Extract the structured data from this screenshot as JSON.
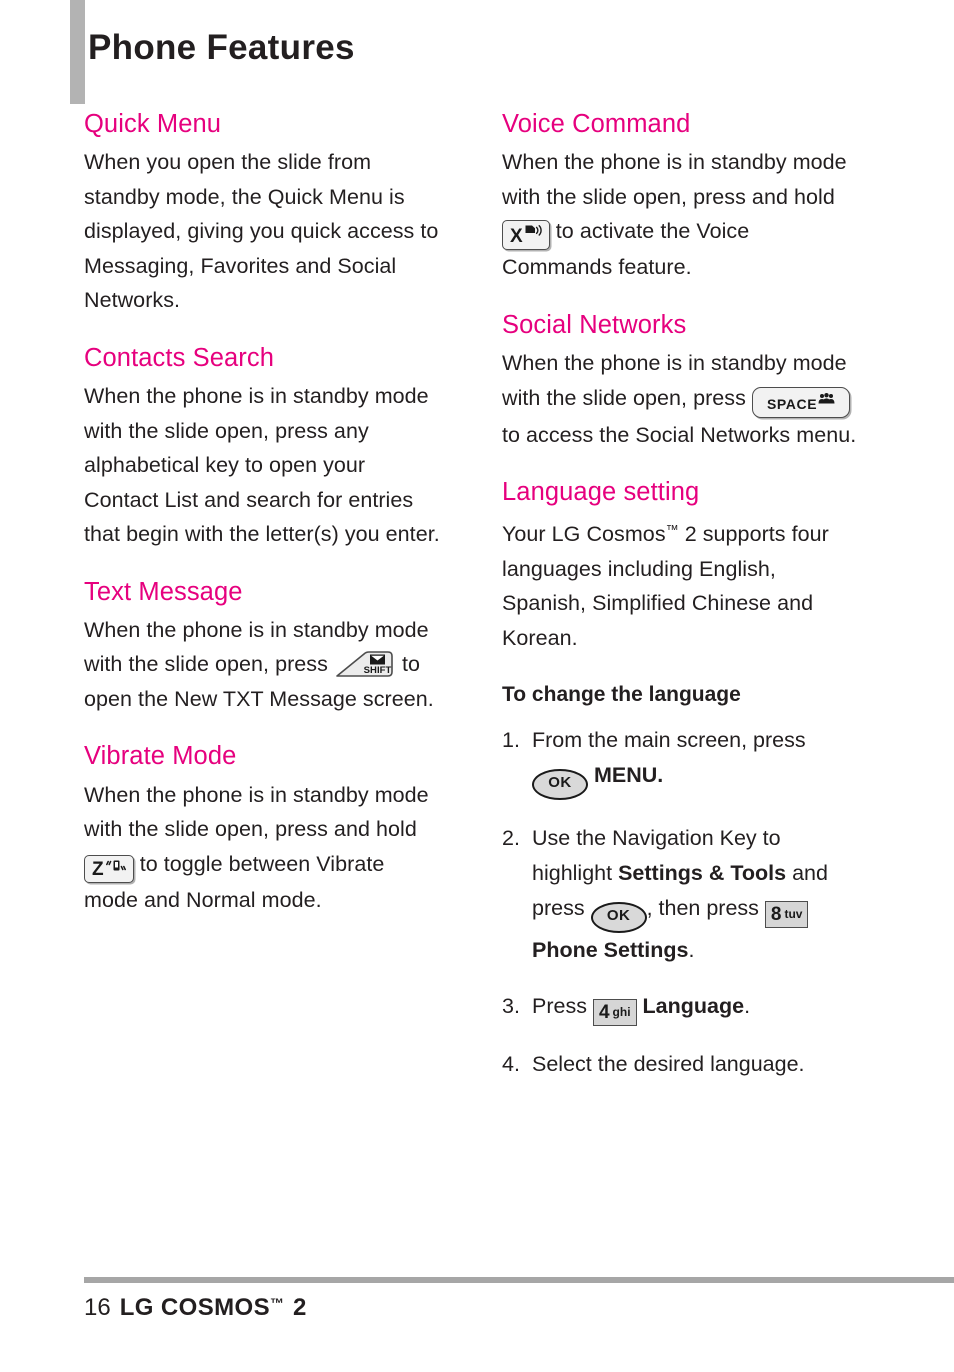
{
  "page": {
    "title": "Phone Features",
    "accent_color": "#E6007E",
    "text_color": "#231F20",
    "tab_color": "#B3B3B3"
  },
  "left_column": {
    "sections": [
      {
        "heading": "Quick Menu",
        "body_before": "When you open the slide from standby mode, the Quick Menu is displayed, giving you quick access to Messaging, Favorites and Social Networks.",
        "key": null,
        "body_after": ""
      },
      {
        "heading": "Contacts Search",
        "body_before": "When the phone is in standby mode with the slide open, press any alphabetical key to open your Contact List and search for entries that begin with the letter(s) you enter.",
        "key": null,
        "body_after": ""
      },
      {
        "heading": "Text Message",
        "body_before": "When the phone is in standby mode with the slide open, press",
        "key": {
          "type": "shift-key",
          "label": "SHIFT",
          "icon": "envelope-icon"
        },
        "body_after": "to open the New TXT Message screen."
      },
      {
        "heading": "Vibrate Mode",
        "body_before": "When the phone is in standby mode with the slide open, press and hold",
        "key": {
          "type": "letter-key",
          "label": "Z",
          "icon": "vibrate-icon"
        },
        "body_after": "to toggle between Vibrate mode and Normal mode."
      }
    ]
  },
  "right_column": {
    "sections": [
      {
        "heading": "Voice Command",
        "body_before": "When the phone is in standby mode with the slide open, press and hold",
        "key": {
          "type": "letter-key",
          "label": "X",
          "icon": "voice-command-icon"
        },
        "body_after": "to activate the Voice Commands feature."
      },
      {
        "heading": "Social Networks",
        "body_before": "When the phone is in standby mode with the slide open, press",
        "key": {
          "type": "space-key",
          "label": "SPACE",
          "icon": "social-group-icon"
        },
        "body_after": "to access the Social Networks menu."
      }
    ],
    "language_section": {
      "heading": "Language setting",
      "intro_part1": "Your LG Cosmos",
      "intro_tm": "™",
      "intro_part2": " 2 supports four languages including English, Spanish, Simplified Chinese and Korean.",
      "sub_heading": "To change the language",
      "steps": [
        {
          "number": "1.",
          "text_before": "From the main screen, press",
          "key": {
            "type": "ok-key",
            "label": "OK"
          },
          "text_bold": "MENU.",
          "text_after": ""
        },
        {
          "number": "2.",
          "text_before": "Use the Navigation Key to highlight",
          "bold_1": "Settings & Tools",
          "mid_1": "and press",
          "key_ok": {
            "type": "ok-key",
            "label": "OK"
          },
          "mid_2": ", then press",
          "key_num": {
            "type": "number-key",
            "digit": "8",
            "letters": "tuv"
          },
          "bold_2": "Phone Settings",
          "text_after": "."
        },
        {
          "number": "3.",
          "text_before": "Press",
          "key_num": {
            "type": "number-key",
            "digit": "4",
            "letters": "ghi"
          },
          "bold_1": "Language",
          "text_after": "."
        },
        {
          "number": "4.",
          "text_before": "Select the desired language.",
          "key": null
        }
      ]
    }
  },
  "footer": {
    "page_number": "16",
    "brand": "LG COSMOS",
    "brand_tm": "™",
    "model": "2"
  }
}
